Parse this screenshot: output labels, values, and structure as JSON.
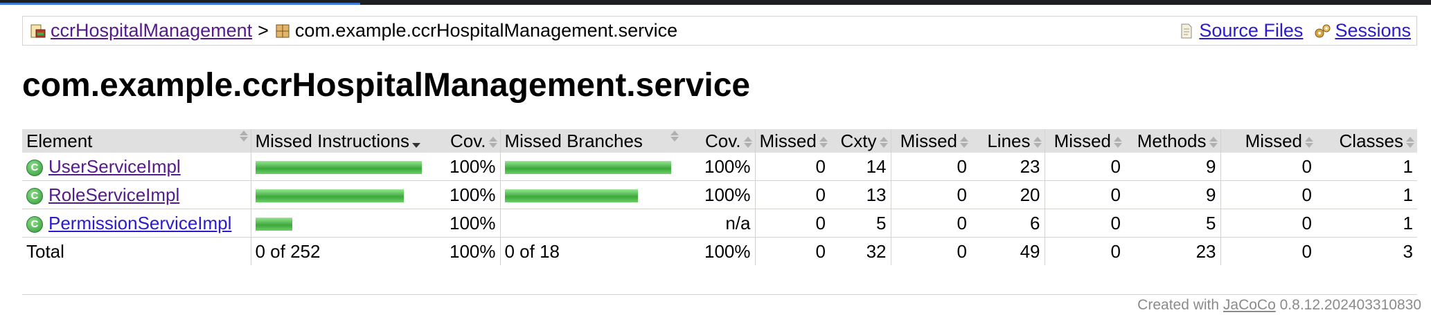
{
  "breadcrumb": {
    "project_label": "ccrHospitalManagement",
    "separator": ">",
    "package_label": "com.example.ccrHospitalManagement.service",
    "source_files_label": "Source Files",
    "sessions_label": "Sessions"
  },
  "page_title": "com.example.ccrHospitalManagement.service",
  "table": {
    "headers": {
      "element": "Element",
      "missed_instructions": "Missed Instructions",
      "cov1": "Cov.",
      "missed_branches": "Missed Branches",
      "cov2": "Cov.",
      "missed_cxty": "Missed",
      "cxty": "Cxty",
      "missed_lines": "Missed",
      "lines": "Lines",
      "missed_methods": "Missed",
      "methods": "Methods",
      "missed_classes": "Missed",
      "classes": "Classes"
    },
    "rows": [
      {
        "name": "UserServiceImpl",
        "instr_bar_fraction": 1.0,
        "instr_cov": "100%",
        "branch_bar_fraction": 1.0,
        "branch_cov": "100%",
        "missed_cxty": "0",
        "cxty": "14",
        "missed_lines": "0",
        "lines": "23",
        "missed_methods": "0",
        "methods": "9",
        "missed_classes": "0",
        "classes": "1"
      },
      {
        "name": "RoleServiceImpl",
        "instr_bar_fraction": 0.89,
        "instr_cov": "100%",
        "branch_bar_fraction": 0.8,
        "branch_cov": "100%",
        "missed_cxty": "0",
        "cxty": "13",
        "missed_lines": "0",
        "lines": "20",
        "missed_methods": "0",
        "methods": "9",
        "missed_classes": "0",
        "classes": "1"
      },
      {
        "name": "PermissionServiceImpl",
        "instr_bar_fraction": 0.22,
        "instr_cov": "100%",
        "branch_bar_fraction": 0,
        "branch_cov": "n/a",
        "missed_cxty": "0",
        "cxty": "5",
        "missed_lines": "0",
        "lines": "6",
        "missed_methods": "0",
        "methods": "5",
        "missed_classes": "0",
        "classes": "1"
      }
    ],
    "total": {
      "label": "Total",
      "instructions": "0 of 252",
      "instr_cov": "100%",
      "branches": "0 of 18",
      "branch_cov": "100%",
      "missed_cxty": "0",
      "cxty": "32",
      "missed_lines": "0",
      "lines": "49",
      "missed_methods": "0",
      "methods": "23",
      "missed_classes": "0",
      "classes": "3"
    }
  },
  "footer": {
    "prefix": "Created with",
    "link": "JaCoCo",
    "version": "0.8.12.202403310830"
  },
  "icons": {
    "project": "report-icon",
    "package": "package-icon",
    "source_files": "document-icon",
    "sessions": "gears-icon",
    "class": "class-icon"
  },
  "colors": {
    "bar_green": "#3ca83a",
    "link": "#2b1bcc",
    "visited": "#551a8b",
    "header_bg": "#e0e0e0"
  }
}
